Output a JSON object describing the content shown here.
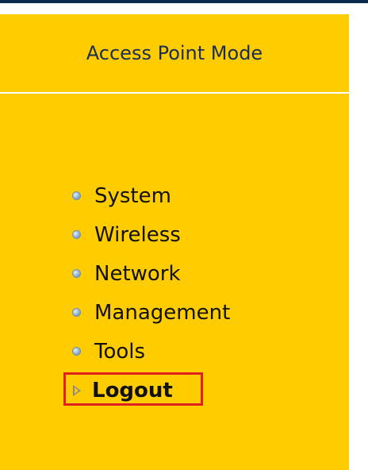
{
  "header": {
    "title": "Access Point Mode"
  },
  "menu": {
    "items": [
      {
        "label": "System",
        "icon": "bullet-icon"
      },
      {
        "label": "Wireless",
        "icon": "bullet-icon"
      },
      {
        "label": "Network",
        "icon": "bullet-icon"
      },
      {
        "label": "Management",
        "icon": "bullet-icon"
      },
      {
        "label": "Tools",
        "icon": "bullet-icon"
      },
      {
        "label": "Logout",
        "icon": "triangle-right-icon",
        "highlighted": true
      }
    ]
  },
  "colors": {
    "panel_background": "#ffcc00",
    "top_bar": "#0d2a4f",
    "header_text": "#1a2d55",
    "highlight_border": "#e01f1f"
  }
}
